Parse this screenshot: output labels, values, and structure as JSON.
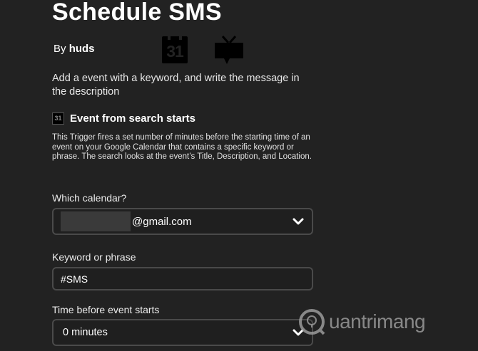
{
  "header": {
    "title": "Schedule SMS",
    "by_label": "By",
    "author": "huds",
    "calendar_logo_text": "31"
  },
  "description": "Add a event with a keyword, and write the message in the description",
  "trigger": {
    "icon_text": "31",
    "title": "Event from search starts",
    "description": "This Trigger fires a set number of minutes before the starting time of an event on your Google Calendar that contains a specific keyword or phrase. The search looks at the event’s Title, Description, and Location."
  },
  "fields": {
    "calendar": {
      "label": "Which calendar?",
      "value_suffix": "@gmail.com"
    },
    "keyword": {
      "label": "Keyword or phrase",
      "value": "#SMS"
    },
    "time_before": {
      "label": "Time before event starts",
      "value": "0 minutes"
    }
  },
  "watermark": {
    "text": "uantrimang"
  },
  "colors": {
    "background": "#222222",
    "field_border": "#4a4a4a",
    "text": "#ffffff"
  }
}
